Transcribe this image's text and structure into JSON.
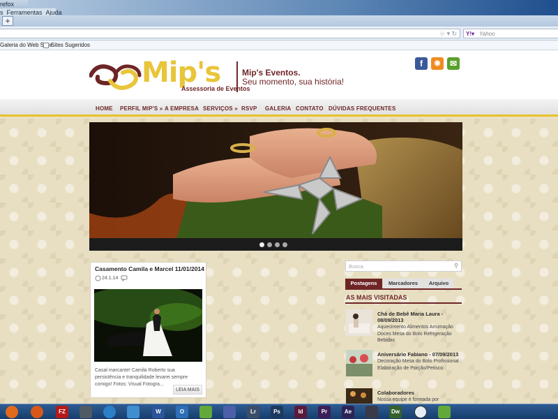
{
  "browser": {
    "title_partial": "refox",
    "menu": [
      "s",
      "Ferramentas",
      "Ajuda"
    ],
    "new_tab": "+",
    "search_placeholder": "Yahoo",
    "search_engine_icon": "yahoo-icon",
    "bookmarks": [
      "Galeria do Web Slice",
      "Sites Sugeridos"
    ]
  },
  "site": {
    "logo_text": "Mip's",
    "logo_subtitle": "Assessoria de Eventos",
    "tagline_1": "Mip's Eventos.",
    "tagline_2": "Seu momento, sua história!",
    "social": [
      {
        "name": "facebook-icon",
        "glyph": "f",
        "color": "#3b5998"
      },
      {
        "name": "rss-icon",
        "glyph": "◉",
        "color": "#f08b21"
      },
      {
        "name": "email-icon",
        "glyph": "✉",
        "color": "#5aa02c"
      }
    ],
    "nav": [
      "HOME",
      "PERFIL MIP'S »",
      "A EMPRESA",
      "SERVIÇOS »",
      "RSVP",
      "GALERIA",
      "CONTATO",
      "DÚVIDAS FREQUENTES"
    ],
    "slider_dots": 4,
    "slider_active": 1
  },
  "post": {
    "title": "Casamento Camila e Marcel 11/01/2014",
    "date": "24.1.14",
    "excerpt": "Casal marcante! Camila Roberto sua persistência e tranquilidade levarei sempre comigo! Fotos: Visual Fotogra...",
    "read_more": "LEIA MAIS"
  },
  "sidebar": {
    "search_placeholder": "Busca",
    "tabs": [
      "Postagens",
      "Marcadores",
      "Arquivo"
    ],
    "active_tab": "Postagens",
    "popular_title": "AS MAIS VISITADAS",
    "popular": [
      {
        "title": "Chá de Bebê Maria Laura - 08/09/2013",
        "desc": " Aquecimento Alimentos  Arrumação Doces Mesa do Bolo Refrigeração Bebidas"
      },
      {
        "title": "Aniversário Fabiano - 07/09/2013",
        "desc": "Decoração Mesa do Bolo Profissional : Elaboração de Porção/Petisco"
      },
      {
        "title": "Colaboradores",
        "desc": "Nossa equipe é formada por"
      }
    ]
  },
  "taskbar": {
    "apps": [
      {
        "name": "media-player-icon",
        "label": "",
        "color": "#e26a1c"
      },
      {
        "name": "firefox-icon",
        "label": "",
        "color": "#d8581c"
      },
      {
        "name": "filezilla-icon",
        "label": "FZ",
        "color": "#b51a1a"
      },
      {
        "name": "camera-icon",
        "label": "",
        "color": "#505a66"
      },
      {
        "name": "globe-icon",
        "label": "",
        "color": "#2a7fc9"
      },
      {
        "name": "cube-icon",
        "label": "",
        "color": "#3f8fd0"
      },
      {
        "name": "word-icon",
        "label": "W",
        "color": "#2b579a"
      },
      {
        "name": "outlook-icon",
        "label": "O",
        "color": "#2d6fb6"
      },
      {
        "name": "corel-icon",
        "label": "",
        "color": "#63a83a"
      },
      {
        "name": "inkscape-icon",
        "label": "",
        "color": "#4d5fa8"
      },
      {
        "name": "lightroom-icon",
        "label": "Lr",
        "color": "#3b4e67"
      },
      {
        "name": "photoshop-icon",
        "label": "Ps",
        "color": "#1c3a5e"
      },
      {
        "name": "indesign-icon",
        "label": "Id",
        "color": "#5c1a3b"
      },
      {
        "name": "premiere-icon",
        "label": "Pr",
        "color": "#3c1f57"
      },
      {
        "name": "after-effects-icon",
        "label": "Ae",
        "color": "#2c2456"
      },
      {
        "name": "media-encoder-icon",
        "label": "",
        "color": "#3a3a4a"
      },
      {
        "name": "dreamweaver-icon",
        "label": "Dw",
        "color": "#35612a"
      },
      {
        "name": "clock-icon",
        "label": "",
        "color": "#e7edf4"
      },
      {
        "name": "corel-draw-icon",
        "label": "",
        "color": "#63a83a"
      }
    ]
  }
}
